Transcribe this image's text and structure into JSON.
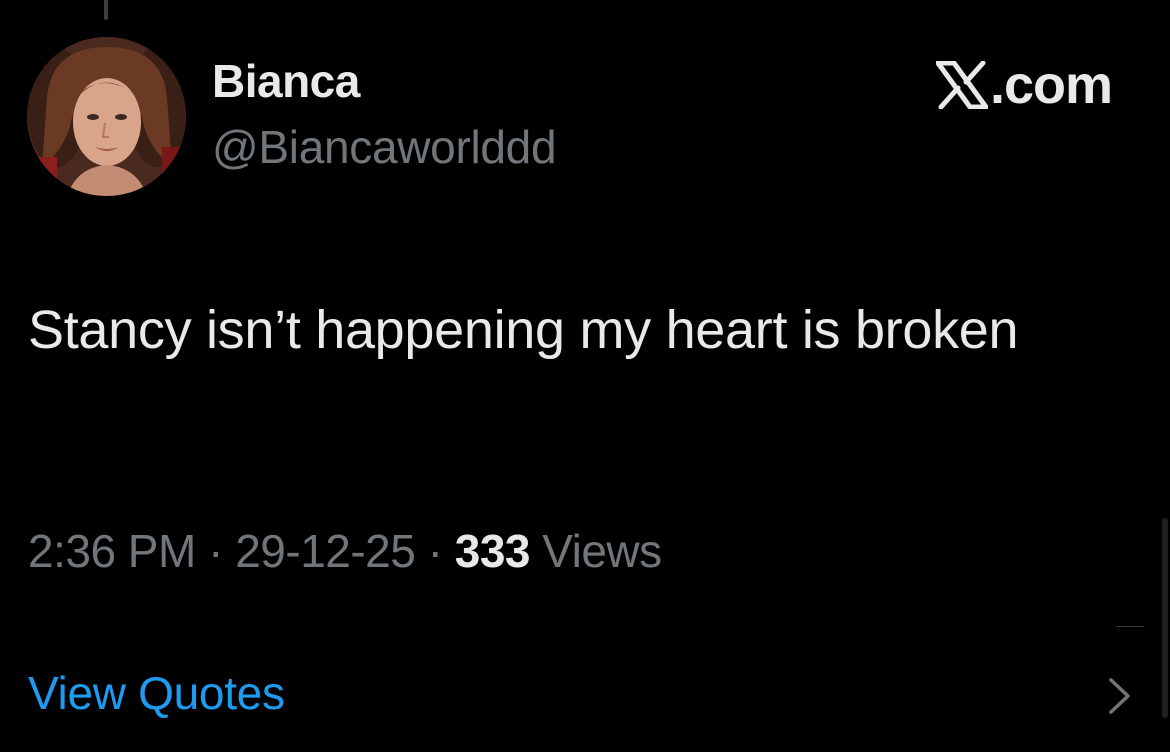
{
  "user": {
    "display_name": "Bianca",
    "handle": "@Biancaworlddd"
  },
  "brand": {
    "label": ".com",
    "icon": "x-logo-icon"
  },
  "tweet": {
    "text": "Stancy isn’t happening my heart is broken"
  },
  "meta": {
    "time": "2:36 PM",
    "separator": "·",
    "date": "29-12-25",
    "views_count": "333",
    "views_label": "Views"
  },
  "actions": {
    "view_quotes": "View Quotes",
    "chevron_icon": "chevron-right-icon"
  },
  "colors": {
    "background": "#000000",
    "primary_text": "#e7e9ea",
    "secondary_text": "#71767b",
    "link": "#1d9bf0"
  }
}
